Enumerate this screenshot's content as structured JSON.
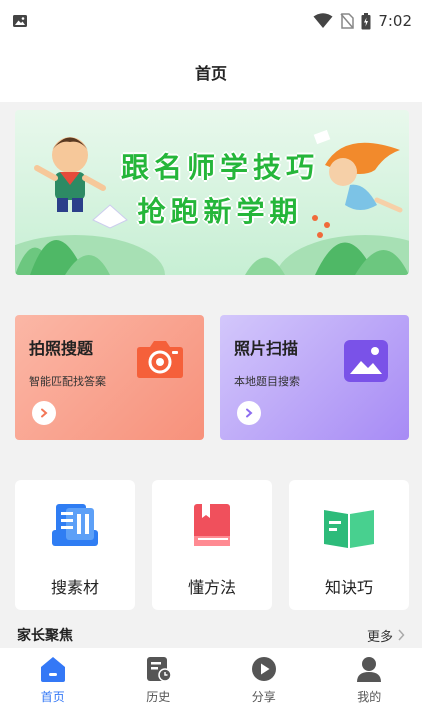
{
  "status_bar": {
    "time": "7:02"
  },
  "header": {
    "title": "首页"
  },
  "banner": {
    "line1": "跟名师学技巧",
    "line2": "抢跑新学期"
  },
  "cards": [
    {
      "title": "拍照搜题",
      "subtitle": "智能匹配找答案",
      "color": "#f98a70",
      "icon": "camera-icon"
    },
    {
      "title": "照片扫描",
      "subtitle": "本地题目搜索",
      "color": "#a385f5",
      "icon": "image-icon"
    }
  ],
  "tools": [
    {
      "label": "搜素材",
      "icon": "document-stack-icon",
      "color": "#2f7df3"
    },
    {
      "label": "懂方法",
      "icon": "red-book-icon",
      "color": "#f0505c"
    },
    {
      "label": "知诀巧",
      "icon": "open-book-icon",
      "color": "#2dbb7a"
    }
  ],
  "section": {
    "title": "家长聚焦",
    "more": "更多"
  },
  "tabs": [
    {
      "label": "首页",
      "icon": "home-icon",
      "active": true
    },
    {
      "label": "历史",
      "icon": "history-icon",
      "active": false
    },
    {
      "label": "分享",
      "icon": "play-share-icon",
      "active": false
    },
    {
      "label": "我的",
      "icon": "user-icon",
      "active": false
    }
  ],
  "colors": {
    "accent": "#3478f6",
    "banner_text": "#25b63a",
    "background": "#f2f2f2"
  }
}
